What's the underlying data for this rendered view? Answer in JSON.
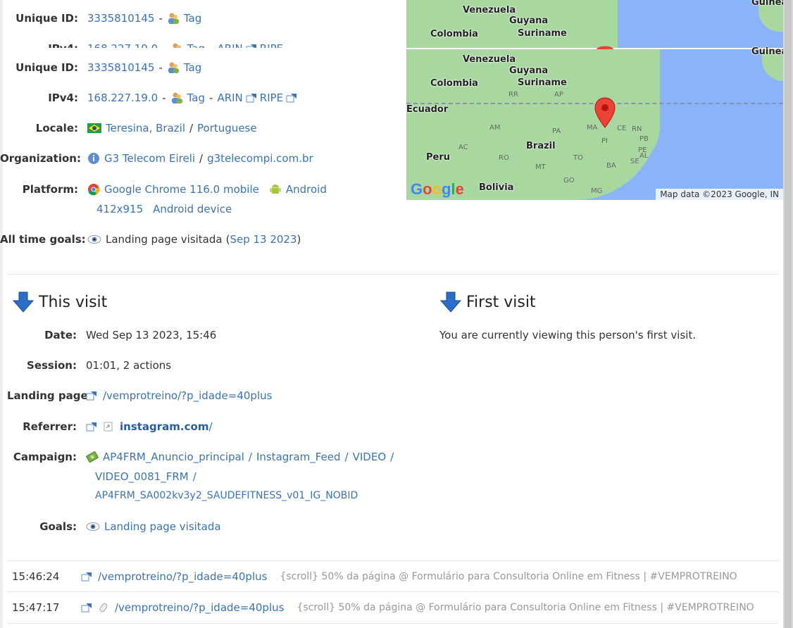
{
  "visitor": {
    "unique_id_label": "Unique ID:",
    "unique_id": "3335810145",
    "tag": "Tag",
    "ipv4_label": "IPv4:",
    "ipv4": "168.227.19.0",
    "arin": "ARIN",
    "ripe": "RIPE",
    "locale_label": "Locale:",
    "location": "Teresina, Brazil",
    "language": "Portuguese",
    "org_label": "Organization:",
    "organization": "G3 Telecom Eireli",
    "org_domain": "g3telecompi.com.br",
    "platform_label": "Platform:",
    "browser": "Google Chrome 116.0 mobile",
    "os": "Android",
    "resolution": "412x915",
    "device": "Android device",
    "goals_label": "All time goals:",
    "goal_name": "Landing page visitada",
    "goal_date": "Sep 13 2023",
    "dash": "-",
    "slash": "/",
    "paren_open": "(",
    "paren_close": ")"
  },
  "map": {
    "labels": [
      "Venezuela",
      "Guyana",
      "Suriname",
      "Colombia",
      "Ecuador",
      "Peru",
      "Brazil",
      "Bolivia"
    ],
    "states": [
      "AM",
      "PA",
      "MA",
      "CE",
      "RN",
      "PB",
      "PE",
      "AL",
      "SE",
      "PI",
      "TO",
      "RO",
      "MT",
      "BA",
      "GO",
      "MG",
      "AC",
      "RR",
      "AP"
    ],
    "logo": "Google",
    "attribution": "Map data ©2023 Google, IN",
    "top_partial": "Guinea"
  },
  "this_visit": {
    "title": "This visit",
    "date_label": "Date:",
    "date": "Wed Sep 13 2023, 15:46",
    "session_label": "Session:",
    "session": "01:01, 2 actions",
    "landing_label": "Landing page:",
    "landing": "/vemprotreino/?p_idade=40plus",
    "referrer_label": "Referrer:",
    "referrer_domain": "instagram.com",
    "referrer_path": "/",
    "campaign_label": "Campaign:",
    "campaign_line1": [
      "AP4FRM_Anuncio_principal",
      "Instagram_Feed",
      "VIDEO"
    ],
    "campaign_line2": "VIDEO_0081_FRM",
    "campaign_line3": "AP4FRM_SA002kv3y2_SAUDEFITNESS_v01_IG_NOBID",
    "goals_label": "Goals:",
    "goal": "Landing page visitada"
  },
  "first_visit": {
    "title": "First visit",
    "message": "You are currently viewing this person's first visit."
  },
  "actions": [
    {
      "time": "15:46:24",
      "url": "/vemprotreino/?p_idade=40plus",
      "note": "{scroll} 50% da página @ Formulário para Consultoria Online em Fitness | #VEMPROTREINO"
    },
    {
      "time": "15:47:17",
      "url": "/vemprotreino/?p_idade=40plus",
      "note": "{scroll} 50% da página @ Formulário para Consultoria Online em Fitness | #VEMPROTREINO"
    }
  ]
}
